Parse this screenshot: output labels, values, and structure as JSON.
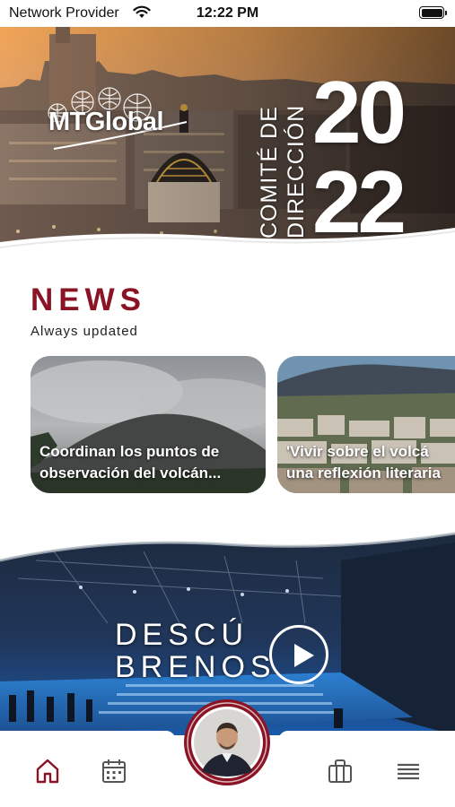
{
  "status_bar": {
    "carrier": "Network Provider",
    "time": "12:22 PM",
    "wifi_icon": "wifi-icon",
    "battery_icon": "battery-icon"
  },
  "hero": {
    "logo_text": "MTGlobal",
    "comite_line_1": "COMITÉ DE",
    "comite_line_2": "DIRECCIÓN",
    "year_top": "20",
    "year_bottom": "22"
  },
  "news": {
    "title": "NEWS",
    "subtitle": "Always updated",
    "items": [
      {
        "title_line_1": "Coordinan los puntos de",
        "title_line_2": "observación del volcán..."
      },
      {
        "title_line_1": "'Vivir sobre el volcá",
        "title_line_2": "una reflexión literaria"
      }
    ]
  },
  "video": {
    "title_line_1": "DESCÚ",
    "title_line_2": "BRENOS",
    "play_icon": "play-icon"
  },
  "tab_bar": {
    "items": [
      {
        "icon": "home-icon",
        "active": true
      },
      {
        "icon": "calendar-icon",
        "active": false
      },
      {
        "icon": "profile-avatar",
        "active": false
      },
      {
        "icon": "briefcase-icon",
        "active": false
      },
      {
        "icon": "menu-icon",
        "active": false
      }
    ]
  },
  "colors": {
    "brand": "#8a1425",
    "icon_gray": "#555555",
    "background": "#ffffff"
  }
}
